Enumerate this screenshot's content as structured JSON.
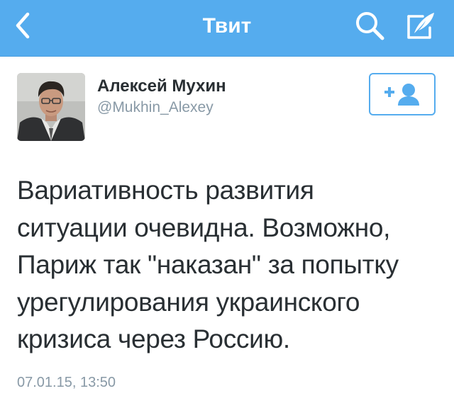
{
  "header": {
    "title": "Твит",
    "back_icon": "chevron-left-icon",
    "search_icon": "search-icon",
    "compose_icon": "compose-icon",
    "bar_color": "#55acee"
  },
  "tweet": {
    "author_name": "Алексей Мухин",
    "author_handle": "@Mukhin_Alexey",
    "follow_icon": "add-user-icon",
    "text_lines": [
      "Вариативность развития",
      "ситуации очевидна. Возможно,",
      "Париж так \"наказан\" за попытку",
      "урегулирования украинского",
      "кризиса через Россию."
    ],
    "timestamp": "07.01.15, 13:50"
  }
}
